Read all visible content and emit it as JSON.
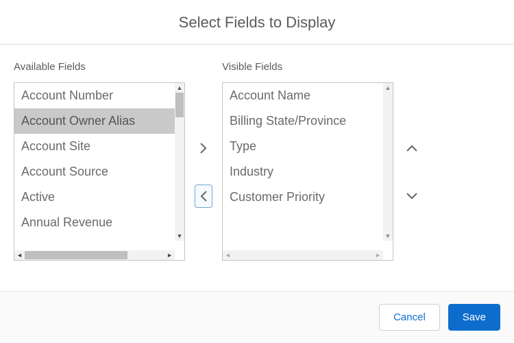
{
  "title": "Select Fields to Display",
  "available": {
    "label": "Available Fields",
    "items": [
      "Account Number",
      "Account Owner Alias",
      "Account Site",
      "Account Source",
      "Active",
      "Annual Revenue"
    ],
    "selected_index": 1
  },
  "visible": {
    "label": "Visible Fields",
    "items": [
      "Account Name",
      "Billing State/Province",
      "Type",
      "Industry",
      "Customer Priority"
    ]
  },
  "buttons": {
    "cancel": "Cancel",
    "save": "Save"
  }
}
